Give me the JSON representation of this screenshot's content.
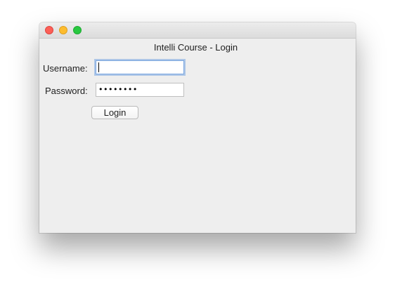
{
  "window": {
    "title": "Intelli Course - Login"
  },
  "titlebar": {
    "controls": [
      {
        "name": "close",
        "color": "#fc5f57"
      },
      {
        "name": "minimize",
        "color": "#fdbc2e"
      },
      {
        "name": "maximize",
        "color": "#28c840"
      }
    ]
  },
  "form": {
    "username_label": "Username:",
    "username_value": "",
    "password_label": "Password:",
    "password_value": "••••••••",
    "login_label": "Login"
  },
  "colors": {
    "window_bg": "#eeeeee",
    "focus_ring": "#7aa7e0"
  }
}
